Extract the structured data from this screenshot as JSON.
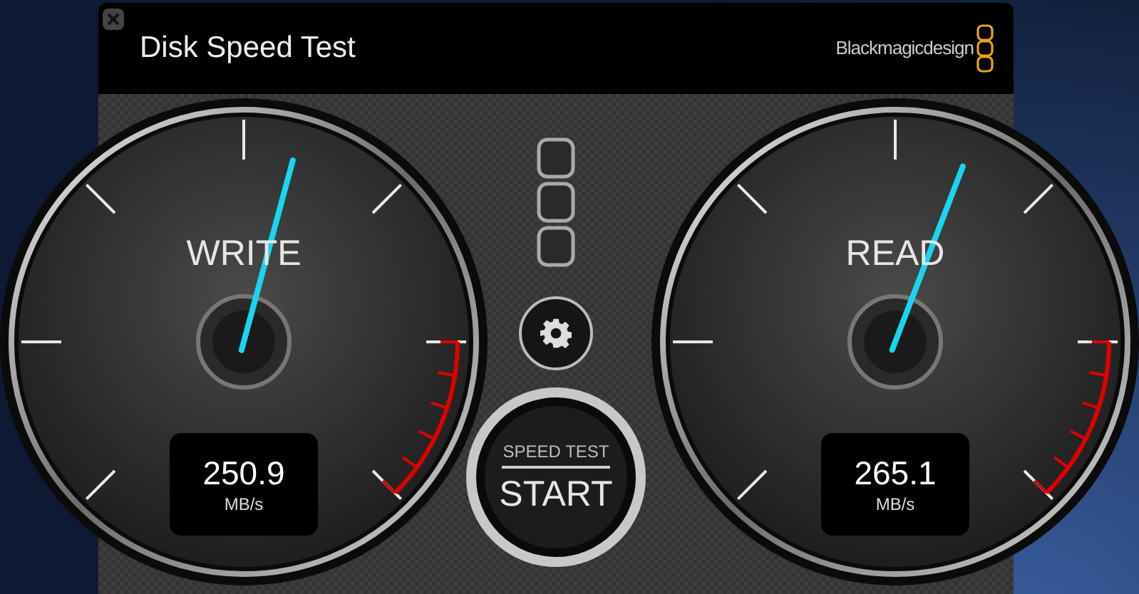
{
  "window": {
    "title": "Disk Speed Test",
    "brand": "Blackmagicdesign"
  },
  "gauges": [
    {
      "label": "WRITE",
      "level": 0.556,
      "value": "250.9",
      "unit": "MB/s"
    },
    {
      "label": "READ",
      "level": 0.578,
      "value": "265.1",
      "unit": "MB/s"
    }
  ],
  "start_button": {
    "caption": "SPEED TEST",
    "label": "START"
  }
}
